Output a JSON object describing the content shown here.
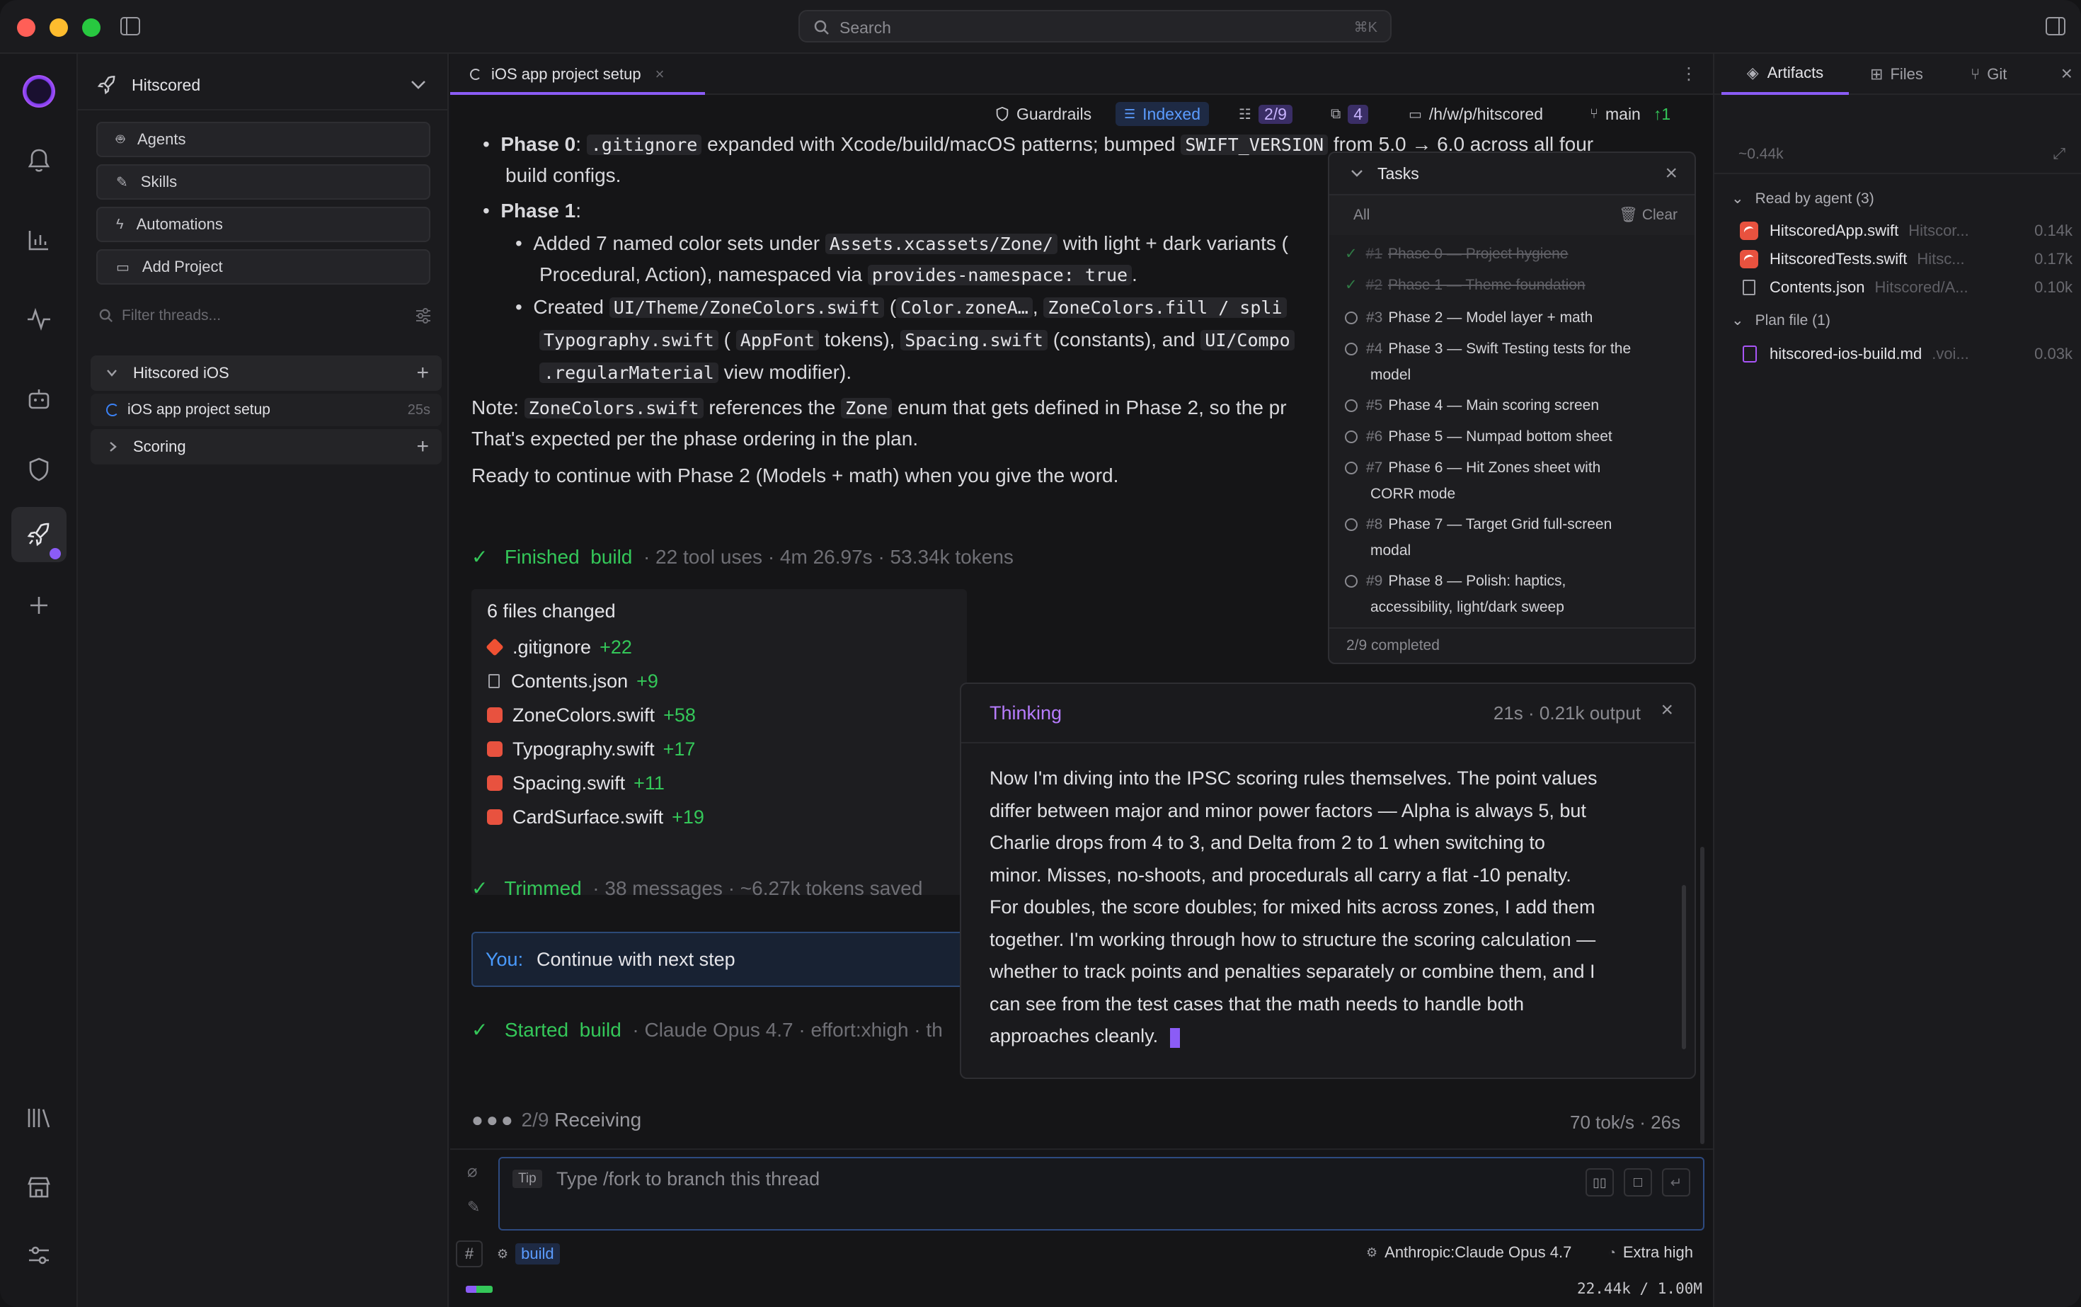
{
  "search": {
    "placeholder": "Search",
    "shortcut": "⌘K"
  },
  "sidebar": {
    "project": "Hitscored",
    "buttons": [
      "Agents",
      "Skills",
      "Automations",
      "Add Project"
    ],
    "filter_placeholder": "Filter threads...",
    "groups": [
      {
        "label": "Hitscored iOS",
        "threads": [
          {
            "label": "iOS app project setup",
            "time": "25s"
          }
        ]
      },
      {
        "label": "Scoring"
      }
    ]
  },
  "tab": {
    "label": "iOS app project setup"
  },
  "toolbar": {
    "guardrails": "Guardrails",
    "indexed": "Indexed",
    "tasks_count": "2/9",
    "copies": "4",
    "path": "/h/w/p/hitscored",
    "branch": "main",
    "ahead": "↑1"
  },
  "chat": {
    "phase0_label": "Phase 0",
    "phase0_a": ":",
    "phase0_code1": ".gitignore",
    "phase0_b": "expanded with Xcode/build/macOS patterns; bumped",
    "phase0_code2": "SWIFT_VERSION",
    "phase0_c": "from 5.0 → 6.0 across all four",
    "phase0_line2": "build configs.",
    "phase1_label": "Phase 1",
    "phase1_a": ":",
    "p1b1_a": "Added 7 named color sets under",
    "p1b1_code": "Assets.xcassets/Zone/",
    "p1b1_b": "with light + dark variants (",
    "p1b1_line2a": "Procedural, Action), namespaced via",
    "p1b1_code2": "provides-namespace: true",
    "p1b1_line2b": ".",
    "p1b2_a": "Created",
    "p1b2_code1": "UI/Theme/ZoneColors.swift",
    "p1b2_b": "(",
    "p1b2_code2": "Color.zoneA…",
    "p1b2_code3": "ZoneColors.fill / spli",
    "p1b2_line2_code1": "Typography.swift",
    "p1b2_line2_a": "(",
    "p1b2_line2_code2": "AppFont",
    "p1b2_line2_b": "tokens),",
    "p1b2_line2_code3": "Spacing.swift",
    "p1b2_line2_c": "(constants), and",
    "p1b2_line2_code4": "UI/Compo",
    "p1b2_line3_code": ".regularMaterial",
    "p1b2_line3_a": "view modifier).",
    "note_a": "Note:",
    "note_code1": "ZoneColors.swift",
    "note_b": "references the",
    "note_code2": "Zone",
    "note_c": "enum that gets defined in Phase 2, so the pr",
    "note_line2": "That's expected per the phase ordering in the plan.",
    "ready": "Ready to continue with Phase 2 (Models + math) when you give the word.",
    "finished_label": "Finished",
    "finished_tag": "build",
    "finished_meta": "· 22 tool uses · 4m 26.97s · 53.34k tokens",
    "files_title": "6 files changed",
    "files": [
      {
        "name": ".gitignore",
        "delta": "+22"
      },
      {
        "name": "Contents.json",
        "delta": "+9"
      },
      {
        "name": "ZoneColors.swift",
        "delta": "+58"
      },
      {
        "name": "Typography.swift",
        "delta": "+17"
      },
      {
        "name": "Spacing.swift",
        "delta": "+11"
      },
      {
        "name": "CardSurface.swift",
        "delta": "+19"
      }
    ],
    "trimmed_label": "Trimmed",
    "trimmed_meta": "· 38 messages · ~6.27k tokens saved",
    "you_label": "You:",
    "you_text": "Continue with next step",
    "started_label": "Started",
    "started_tag": "build",
    "started_meta": "· Claude Opus 4.7 · effort:xhigh · th",
    "receiving_count": "2/9",
    "receiving": "Receiving",
    "rate": "70 tok/s · 26s"
  },
  "tasks": {
    "title": "Tasks",
    "filter": "All",
    "clear": "Clear",
    "items": [
      {
        "num": "#1",
        "text": "Phase 0 — Project hygiene",
        "done": true
      },
      {
        "num": "#2",
        "text": "Phase 1 — Theme foundation",
        "done": true
      },
      {
        "num": "#3",
        "text": "Phase 2 — Model layer + math",
        "done": false
      },
      {
        "num": "#4",
        "text": "Phase 3 — Swift Testing tests for the",
        "text2": "model",
        "done": false
      },
      {
        "num": "#5",
        "text": "Phase 4 — Main scoring screen",
        "done": false
      },
      {
        "num": "#6",
        "text": "Phase 5 — Numpad bottom sheet",
        "done": false
      },
      {
        "num": "#7",
        "text": "Phase 6 — Hit Zones sheet with",
        "text2": "CORR mode",
        "done": false
      },
      {
        "num": "#8",
        "text": "Phase 7 — Target Grid full-screen",
        "text2": "modal",
        "done": false
      },
      {
        "num": "#9",
        "text": "Phase 8 — Polish: haptics,",
        "text2": "accessibility, light/dark sweep",
        "done": false
      }
    ],
    "footer": "2/9 completed"
  },
  "thinking": {
    "title": "Thinking",
    "meta": "21s · 0.21k output",
    "lines": [
      "Now I'm diving into the IPSC scoring rules themselves. The point values",
      "differ between major and minor power factors — Alpha is always 5, but",
      "Charlie drops from 4 to 3, and Delta from 2 to 1 when switching to",
      "minor. Misses, no-shoots, and procedurals all carry a flat -10 penalty.",
      "For doubles, the score doubles; for mixed hits across zones, I add them",
      "together. I'm working through how to structure the scoring calculation —",
      "whether to track points and penalties separately or combine them, and I",
      "can see from the test cases that the math needs to handle both",
      "approaches cleanly."
    ]
  },
  "composer": {
    "tip_label": "Tip",
    "placeholder": "Type /fork to branch this thread",
    "mode": "build",
    "model": "Anthropic:Claude Opus 4.7",
    "effort": "Extra high",
    "context": "22.44k / 1.00M",
    "context_fraction": 0.0224
  },
  "panel": {
    "tabs": [
      "Artifacts",
      "Files",
      "Git"
    ],
    "size": "~0.44k",
    "section1": "Read by agent (3)",
    "read_files": [
      {
        "name": "HitscoredApp.swift",
        "path": "Hitscor...",
        "size": "0.14k"
      },
      {
        "name": "HitscoredTests.swift",
        "path": "Hitsc...",
        "size": "0.17k"
      },
      {
        "name": "Contents.json",
        "path": "Hitscored/A...",
        "size": "0.10k"
      }
    ],
    "section2": "Plan file (1)",
    "plan_files": [
      {
        "name": "hitscored-ios-build.md",
        "path": ".voi...",
        "size": "0.03k"
      }
    ]
  },
  "colors": {
    "accent": "#a855f7",
    "green": "#34c759",
    "blue": "#3b82f6"
  }
}
